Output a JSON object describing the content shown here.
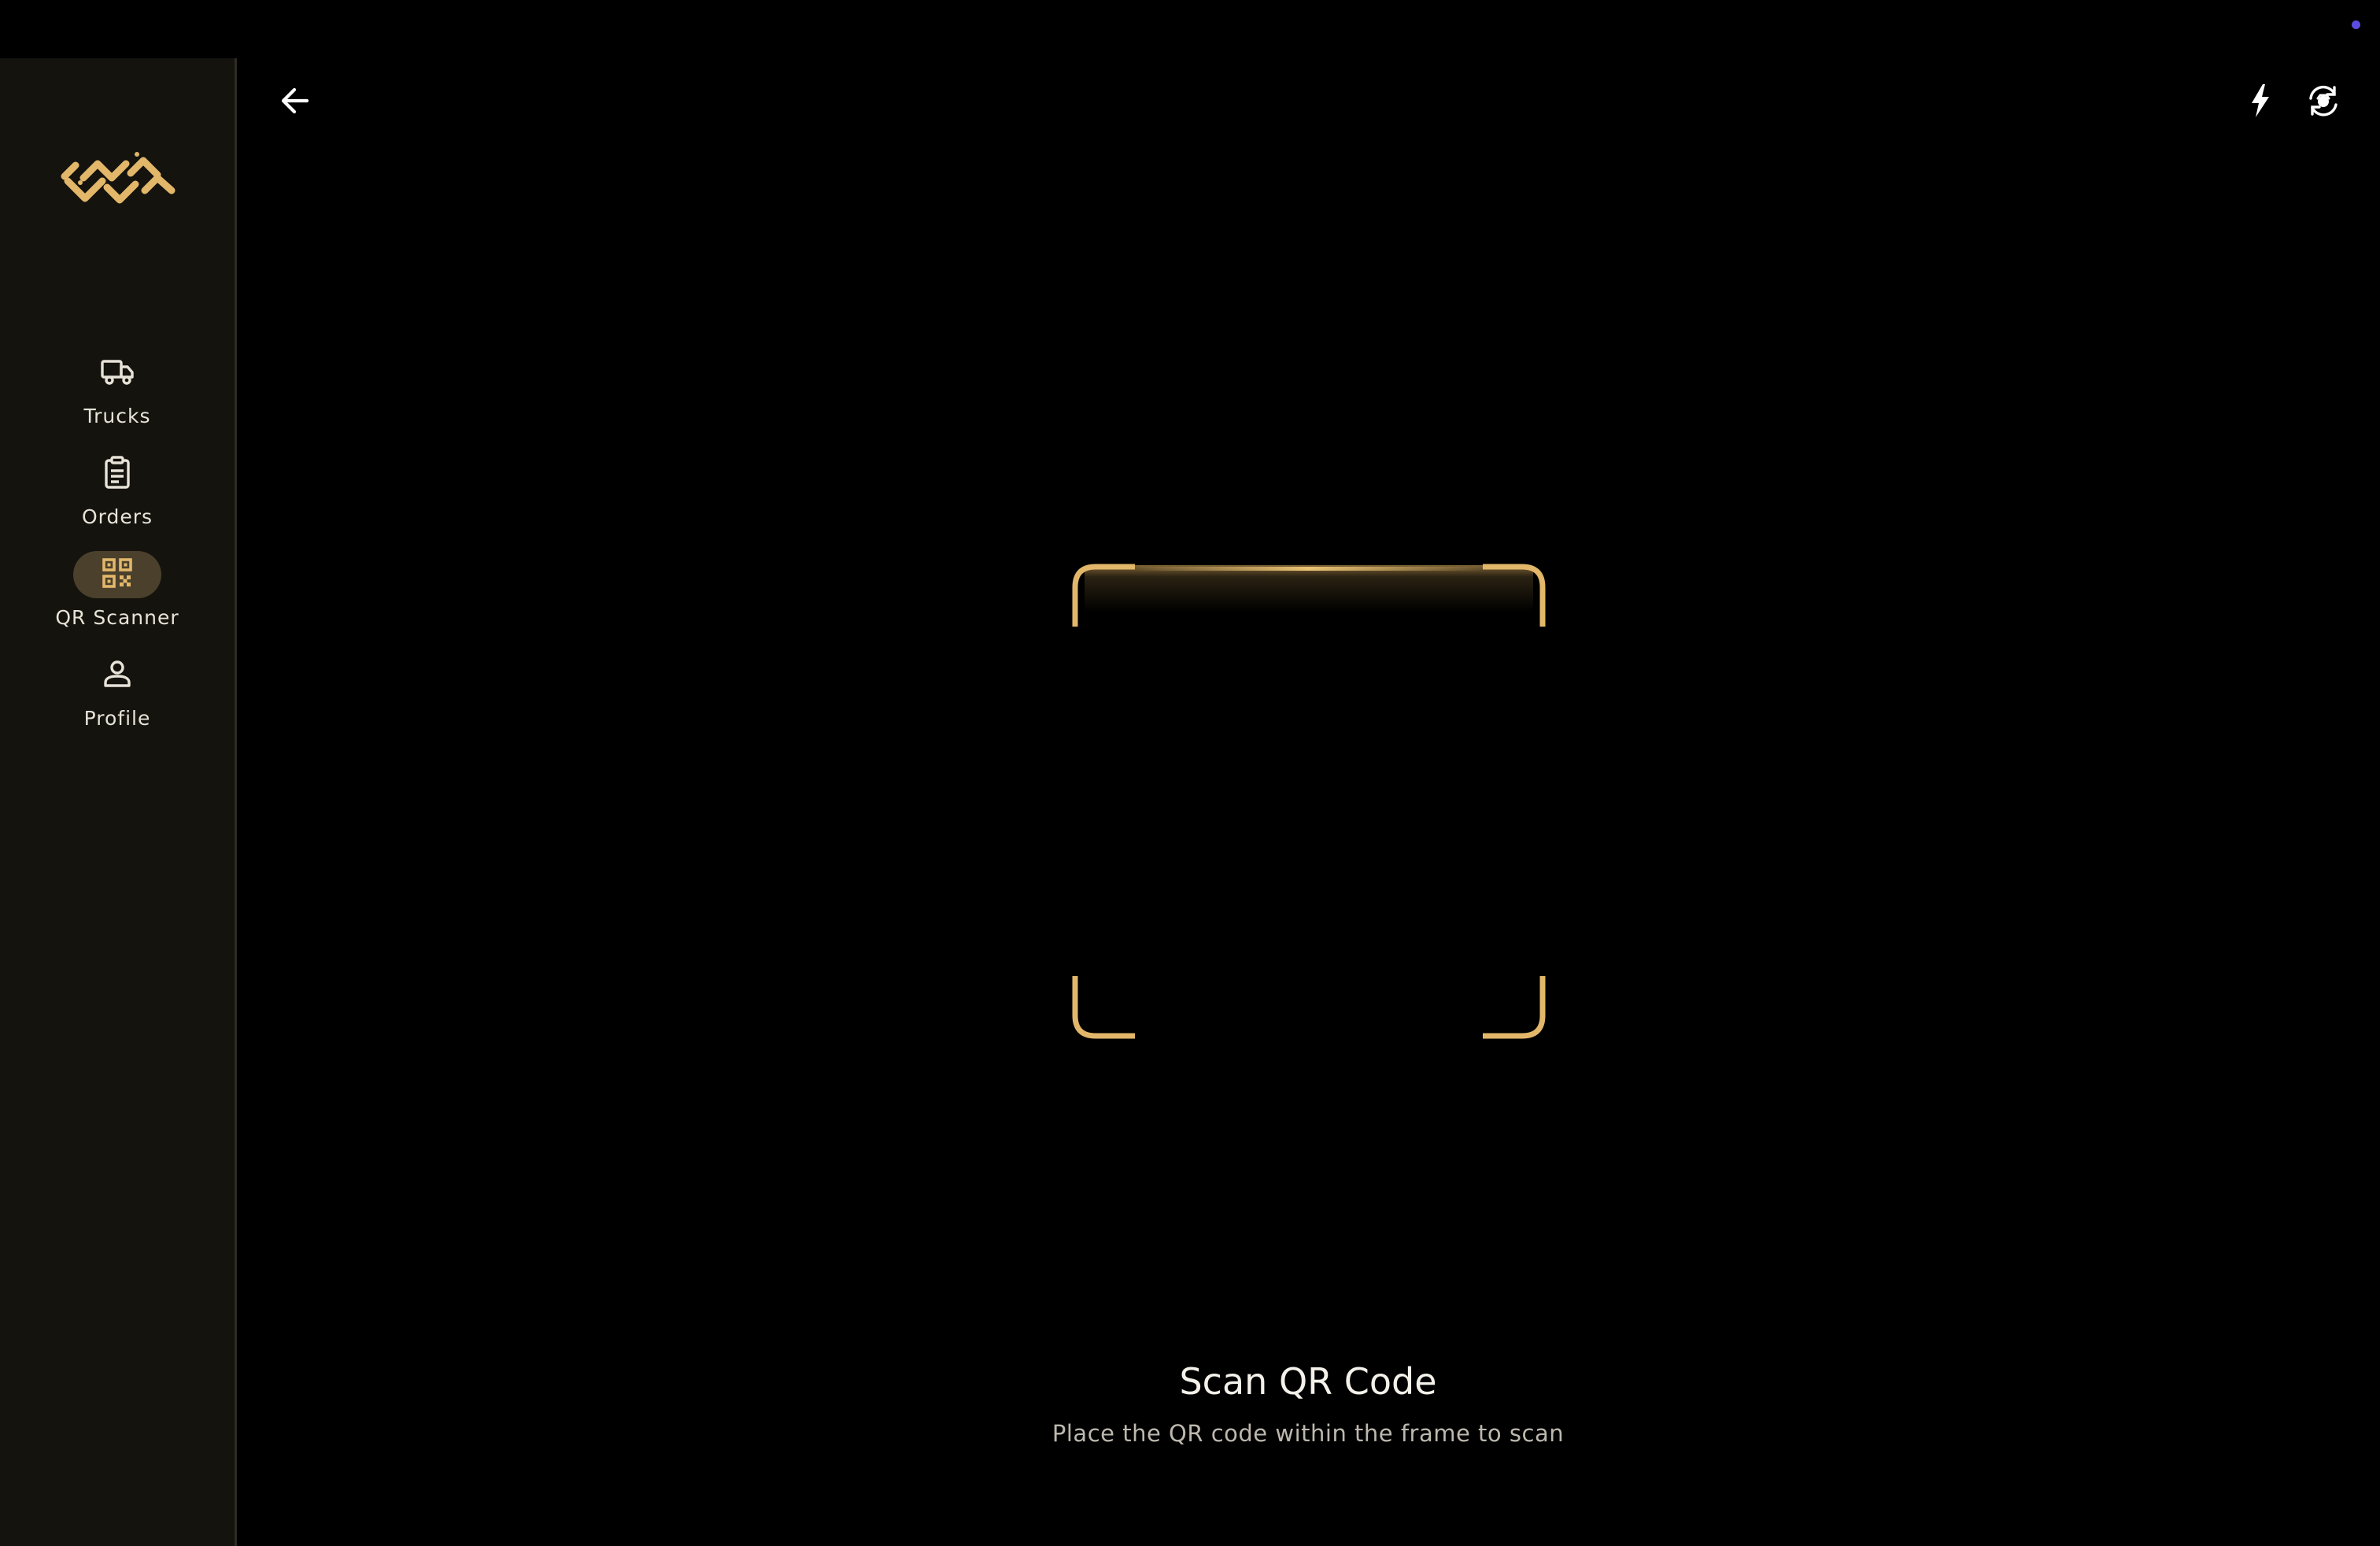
{
  "app": {
    "brand_logo": "brand-logo-mark",
    "accent_color": "#e2b76a",
    "status_indicator_color": "#5b4de0"
  },
  "sidebar": {
    "items": [
      {
        "label": "Trucks",
        "icon": "truck-icon",
        "active": false
      },
      {
        "label": "Orders",
        "icon": "clipboard-icon",
        "active": false
      },
      {
        "label": "QR Scanner",
        "icon": "qr-code-icon",
        "active": true
      },
      {
        "label": "Profile",
        "icon": "person-icon",
        "active": false
      }
    ]
  },
  "toolbar": {
    "back_icon": "arrow-left-icon",
    "flash_icon": "flash-icon",
    "switch_camera_icon": "switch-camera-icon"
  },
  "scanner": {
    "title": "Scan QR Code",
    "instruction": "Place the QR code within the frame to scan"
  }
}
